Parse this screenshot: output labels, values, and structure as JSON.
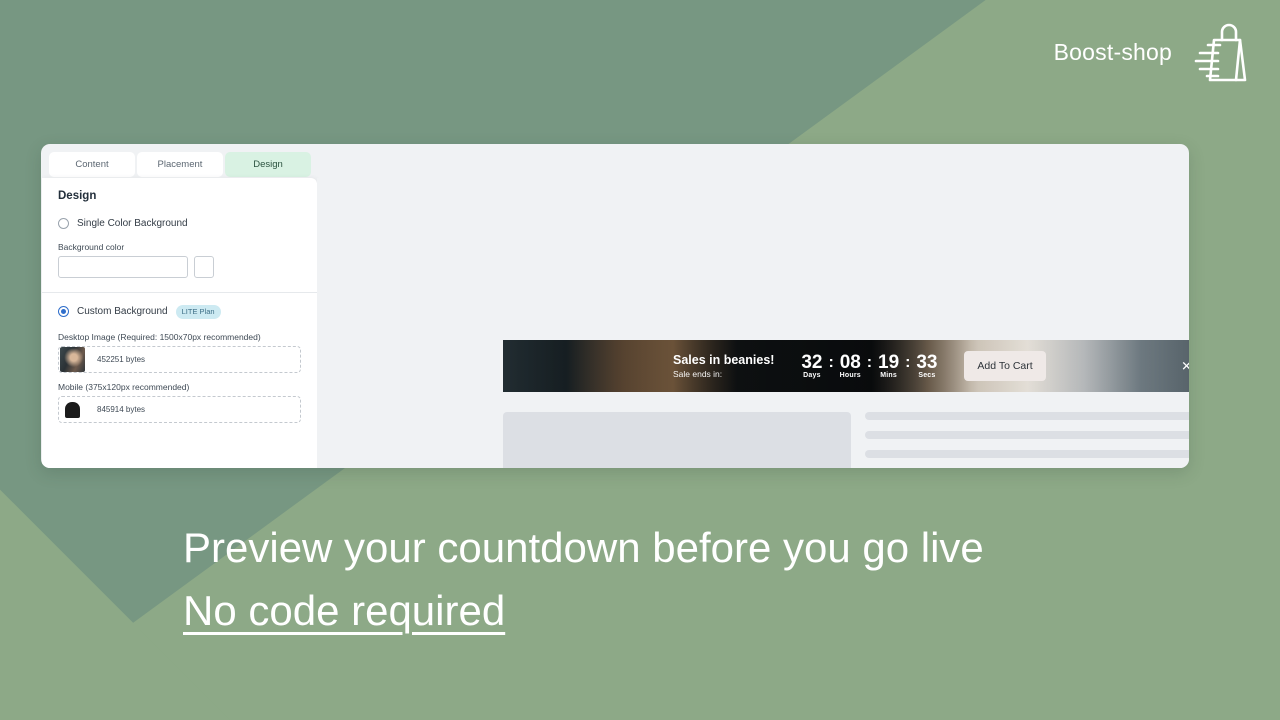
{
  "brand": {
    "name": "Boost-shop",
    "logo_icon": "shopping-bag-icon"
  },
  "theme": {
    "background_green": "#779782",
    "background_green_light": "#8da987",
    "active_tab_green": "#d9f2e3",
    "badge_blue": "#cdeaf2",
    "radio_blue": "#2f6ecb",
    "skeleton_grey": "#dcdfe4",
    "window_grey": "#f0f2f4"
  },
  "app": {
    "tabs": [
      {
        "label": "Content",
        "active": false
      },
      {
        "label": "Placement",
        "active": false
      },
      {
        "label": "Design",
        "active": true
      }
    ],
    "settings": {
      "heading": "Design",
      "single_color_option": {
        "label": "Single Color Background",
        "selected": false
      },
      "background_color_field": {
        "label": "Background color",
        "value": "",
        "placeholder": "",
        "swatch_icon": "color-swatch-icon"
      },
      "custom_background_option": {
        "label": "Custom Background",
        "badge": "LITE Plan",
        "selected": true
      },
      "uploads": [
        {
          "label": "Desktop Image (Required: 1500x70px recommended)",
          "size": "452251 bytes",
          "thumb_icon": "desktop-banner-thumbnail"
        },
        {
          "label": "Mobile (375x120px recommended)",
          "size": "845914 bytes",
          "thumb_icon": "mobile-banner-thumbnail"
        }
      ]
    },
    "preview": {
      "banner": {
        "title": "Sales in beanies!",
        "subtitle": "Sale ends in:",
        "timer": [
          {
            "value": "32",
            "label": "Days"
          },
          {
            "value": "08",
            "label": "Hours"
          },
          {
            "value": "19",
            "label": "Mins"
          },
          {
            "value": "33",
            "label": "Secs"
          }
        ],
        "separator": ":",
        "cta_label": "Add To Cart",
        "close_icon": "close-icon",
        "close_glyph": "✕"
      },
      "skeleton": {
        "line_widths": [
          "100%",
          "100%",
          "100%",
          "79%"
        ]
      }
    }
  },
  "headline": {
    "line1": "Preview your countdown before you go live",
    "line2": "No code required"
  }
}
